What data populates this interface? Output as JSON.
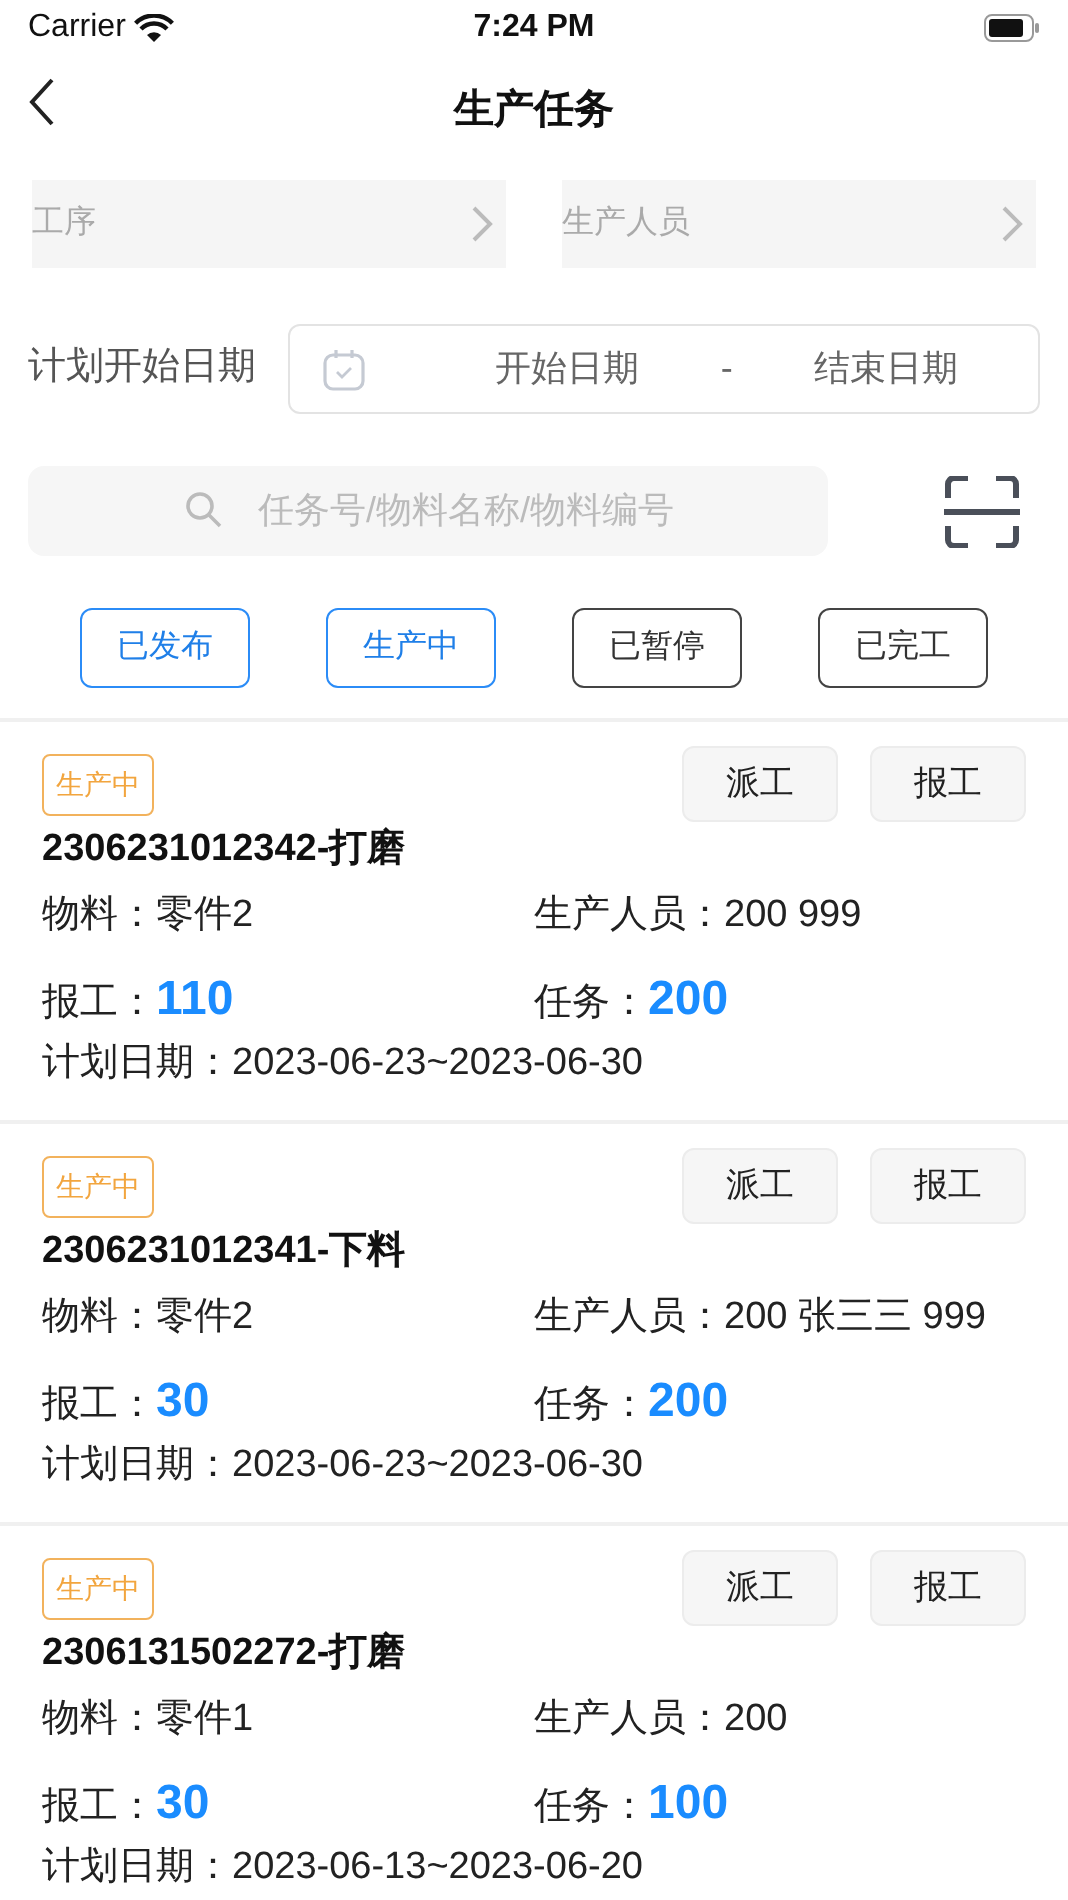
{
  "status_bar": {
    "carrier": "Carrier",
    "time": "7:24 PM"
  },
  "nav": {
    "title": "生产任务"
  },
  "pickers": [
    {
      "placeholder": "工序"
    },
    {
      "placeholder": "生产人员"
    }
  ],
  "date_filter": {
    "label": "计划开始日期",
    "start_placeholder": "开始日期",
    "separator": "-",
    "end_placeholder": "结束日期"
  },
  "search": {
    "placeholder": "任务号/物料名称/物料编号"
  },
  "status_filters": [
    {
      "label": "已发布",
      "selected": true
    },
    {
      "label": "生产中",
      "selected": true
    },
    {
      "label": "已暂停",
      "selected": false
    },
    {
      "label": "已完工",
      "selected": false
    }
  ],
  "tasks": [
    {
      "status": "生产中",
      "buttons": [
        "派工",
        "报工"
      ],
      "title": "2306231012342-打磨",
      "material": "物料：零件2",
      "staff": "生产人员：200 999",
      "reported_label": "报工：",
      "reported": "110",
      "task_label": "任务：",
      "task": "200",
      "plan_date": "计划日期：2023-06-23~2023-06-30"
    },
    {
      "status": "生产中",
      "buttons": [
        "派工",
        "报工"
      ],
      "title": "2306231012341-下料",
      "material": "物料：零件2",
      "staff": "生产人员：200 张三三 999",
      "reported_label": "报工：",
      "reported": "30",
      "task_label": "任务：",
      "task": "200",
      "plan_date": "计划日期：2023-06-23~2023-06-30"
    },
    {
      "status": "生产中",
      "buttons": [
        "派工",
        "报工"
      ],
      "title": "2306131502272-打磨",
      "material": "物料：零件1",
      "staff": "生产人员：200",
      "reported_label": "报工：",
      "reported": "30",
      "task_label": "任务：",
      "task": "100",
      "plan_date": "计划日期：2023-06-13~2023-06-20"
    }
  ]
}
